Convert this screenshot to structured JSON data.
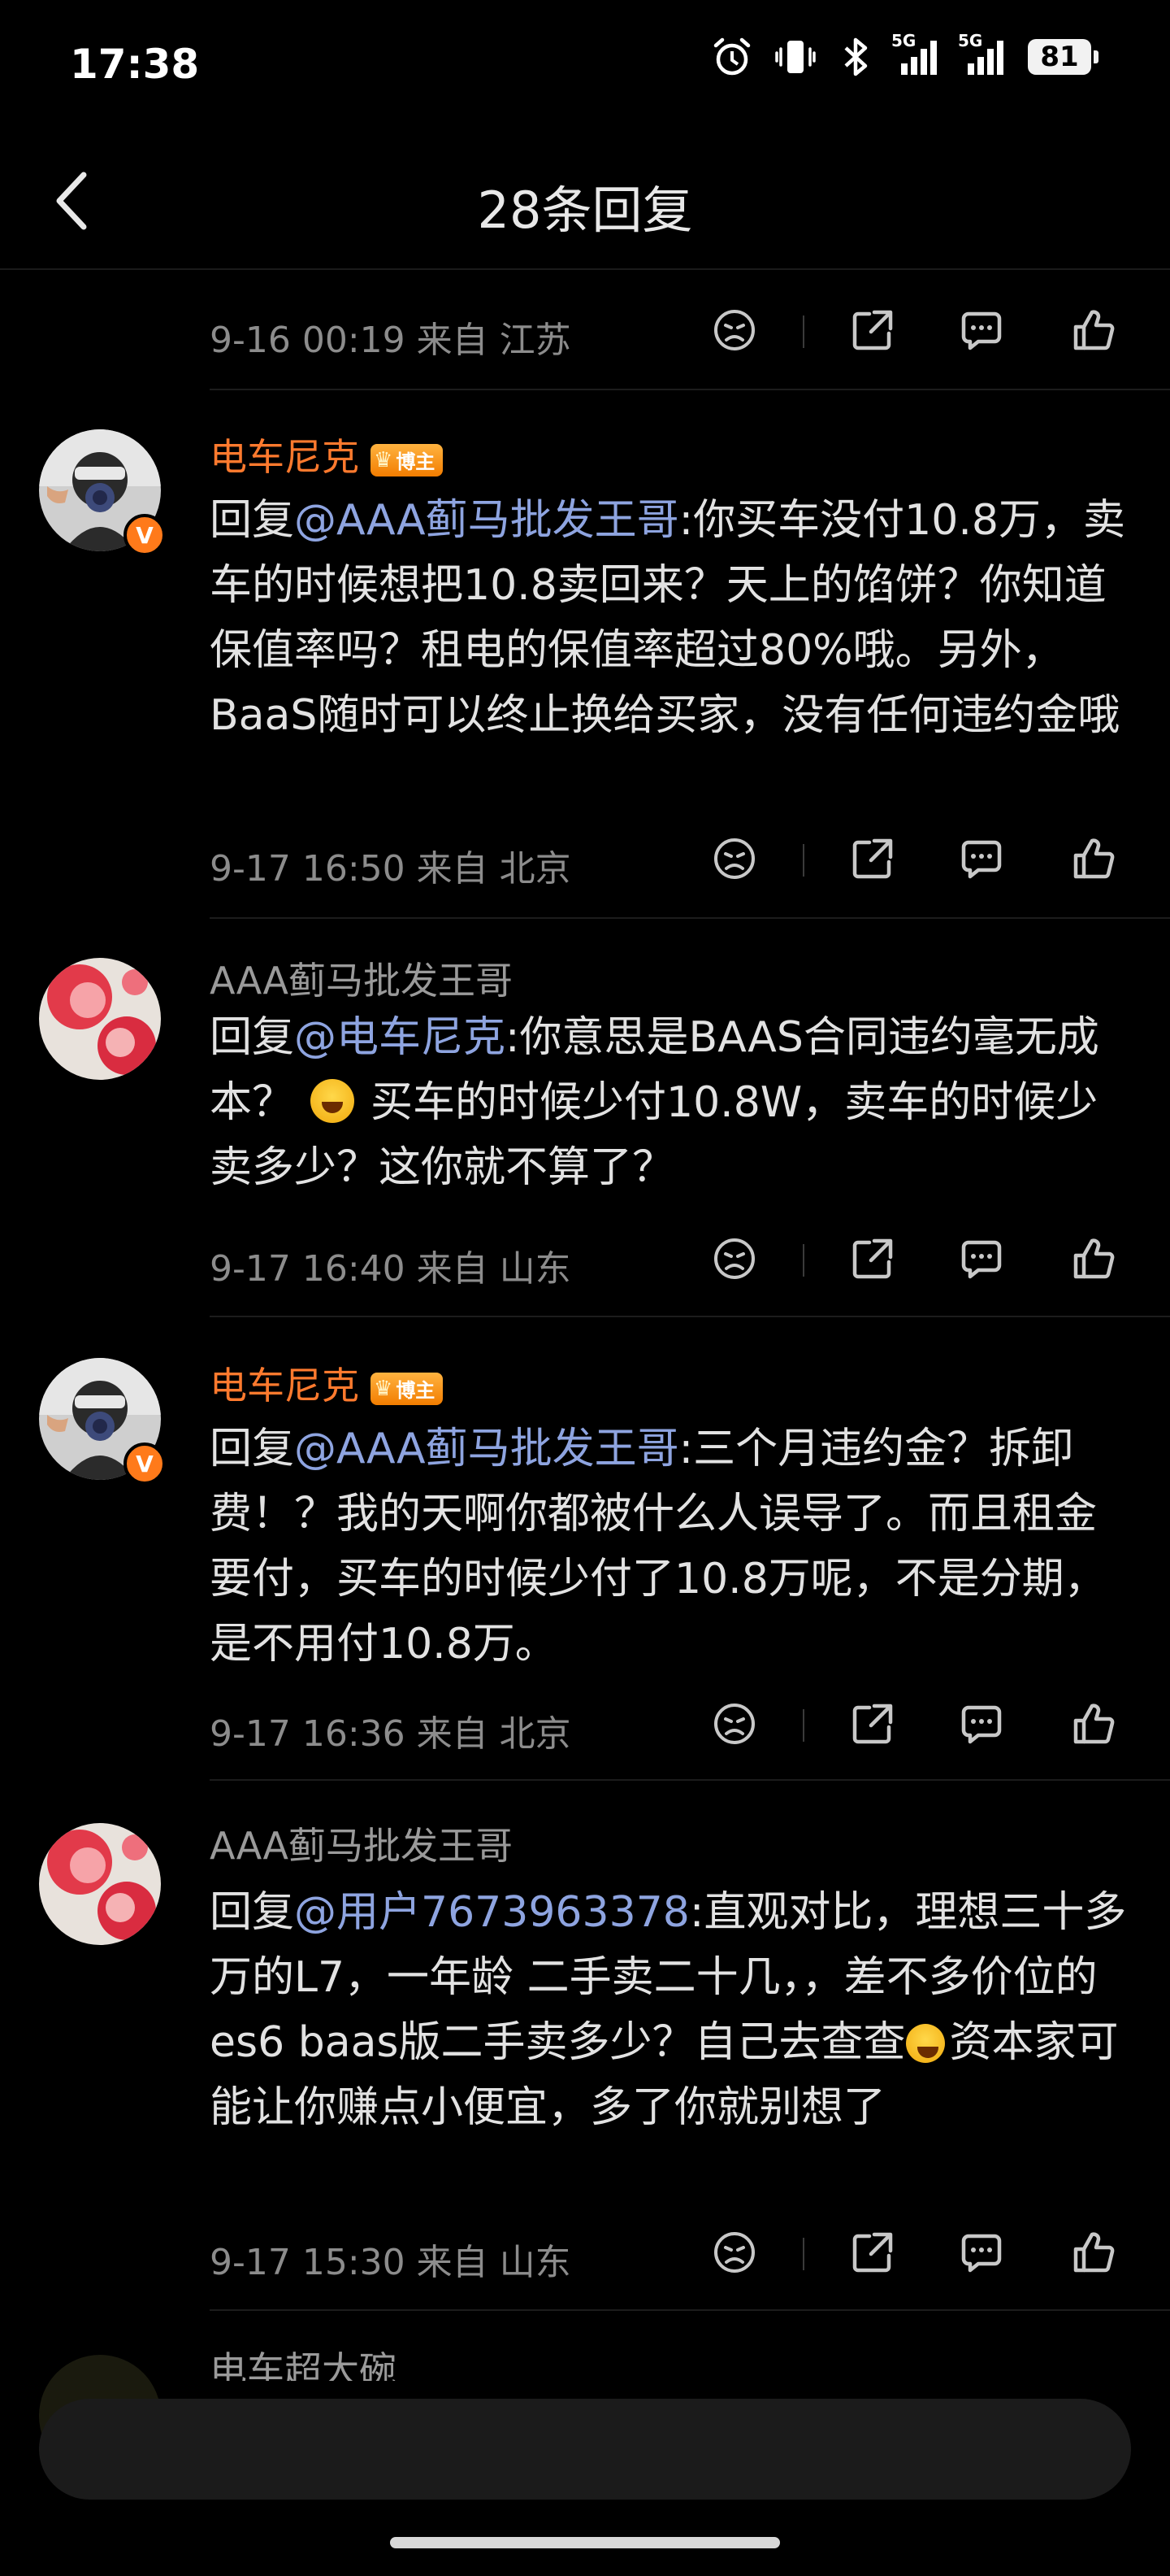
{
  "status_bar": {
    "time": "17:38",
    "network_1": "5G",
    "network_2": "5G",
    "battery": "81"
  },
  "header": {
    "title": "28条回复"
  },
  "comments": [
    {
      "meta": "9-16 00:19  来自 江苏"
    },
    {
      "username": "电车尼克",
      "badge": "博主",
      "avatar_badge": "V",
      "reply_prefix": "回复",
      "mention": "@AAA蓟马批发王哥",
      "text": ":你买车没付10.8万，卖车的时候想把10.8卖回来？天上的馅饼？你知道保值率吗？租电的保值率超过80%哦。另外，BaaS随时可以终止换给买家，没有任何违约金哦",
      "meta": "9-17 16:50  来自 北京"
    },
    {
      "username": "AAA蓟马批发王哥",
      "reply_prefix": "回复",
      "mention": "@电车尼克",
      "text_a": ":你意思是BAAS合同违约毫无成本？",
      "text_b": "买车的时候少付10.8W，卖车的时候少卖多少？这你就不算了？",
      "meta": "9-17 16:40  来自 山东"
    },
    {
      "username": "电车尼克",
      "badge": "博主",
      "avatar_badge": "V",
      "reply_prefix": "回复",
      "mention": "@AAA蓟马批发王哥",
      "text": ":三个月违约金？拆卸费！？我的天啊你都被什么人误导了。而且租金要付，买车的时候少付了10.8万呢，不是分期，是不用付10.8万。",
      "meta": "9-17 16:36  来自 北京"
    },
    {
      "username": "AAA蓟马批发王哥",
      "reply_prefix": "回复",
      "mention": "@用户7673963378",
      "text_a": ":直观对比，理想三十多万的L7，一年龄 二手卖二十几，，差不多价位的es6 baas版二手卖多少？自己去查查",
      "text_b": "资本家可能让你赚点小便宜，多了你就别想了",
      "meta": "9-17 15:30  来自 山东"
    },
    {
      "username": "电车超大碗"
    }
  ],
  "reply_input": {
    "placeholder": ""
  },
  "colors": {
    "background": "#000000",
    "username_blogger": "#ff7a2e",
    "mention": "#8ea4e0",
    "meta": "#8c8c8c"
  }
}
